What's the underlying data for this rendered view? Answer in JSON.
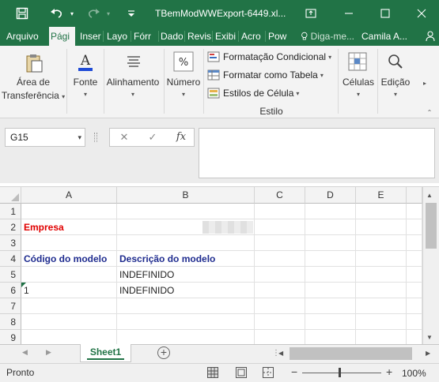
{
  "window": {
    "title": "TBemModWWExport-6449.xl...",
    "quick_access": [
      "save-icon",
      "undo-icon",
      "redo-icon",
      "customize-icon"
    ],
    "controls": [
      "ribbon-display-icon",
      "minimize-icon",
      "maximize-icon",
      "close-icon"
    ]
  },
  "tabs": [
    {
      "label": "Arquivo"
    },
    {
      "label": "Pági"
    },
    {
      "label": "Inser"
    },
    {
      "label": "Layo"
    },
    {
      "label": "Fórr"
    },
    {
      "label": "Dado"
    },
    {
      "label": "Revis"
    },
    {
      "label": "Exibi"
    },
    {
      "label": "Acro"
    },
    {
      "label": "Pow"
    }
  ],
  "tellme": {
    "icon": "lightbulb-icon",
    "label": "Diga-me..."
  },
  "user": {
    "name": "Camila A...",
    "share_icon": "person-icon"
  },
  "ribbon": {
    "clipboard": {
      "label1": "Área de",
      "label2": "Transferência",
      "icon": "clipboard-icon"
    },
    "font": {
      "label": "Fonte",
      "icon": "font-color-icon"
    },
    "alignment": {
      "label": "Alinhamento",
      "icon": "align-icon"
    },
    "number": {
      "label": "Número",
      "icon": "percent-icon"
    },
    "styles": {
      "conditional": "Formatação Condicional",
      "as_table": "Formatar como Tabela",
      "cell_styles": "Estilos de Célula",
      "group_label": "Estilo"
    },
    "cells": {
      "label": "Células",
      "icon": "cells-icon"
    },
    "editing": {
      "label": "Edição",
      "icon": "search-icon"
    }
  },
  "formula_bar": {
    "name_box": "G15",
    "cancel": "✕",
    "enter": "✓",
    "fx": "fx",
    "formula": ""
  },
  "grid": {
    "columns": [
      "A",
      "B",
      "C",
      "D",
      "E"
    ],
    "rows": [
      "1",
      "2",
      "3",
      "4",
      "5",
      "6",
      "7",
      "8",
      "9"
    ],
    "cells": {
      "A2": "Empresa",
      "A4": "Código do modelo",
      "B4": "Descrição do modelo",
      "B5": "INDEFINIDO",
      "A6": "1",
      "B6": "INDEFINIDO"
    }
  },
  "sheets": {
    "active": "Sheet1",
    "add_icon": "plus-circle-icon"
  },
  "status": {
    "text": "Pronto",
    "zoom": "100%",
    "zoom_out": "−",
    "zoom_in": "+"
  }
}
